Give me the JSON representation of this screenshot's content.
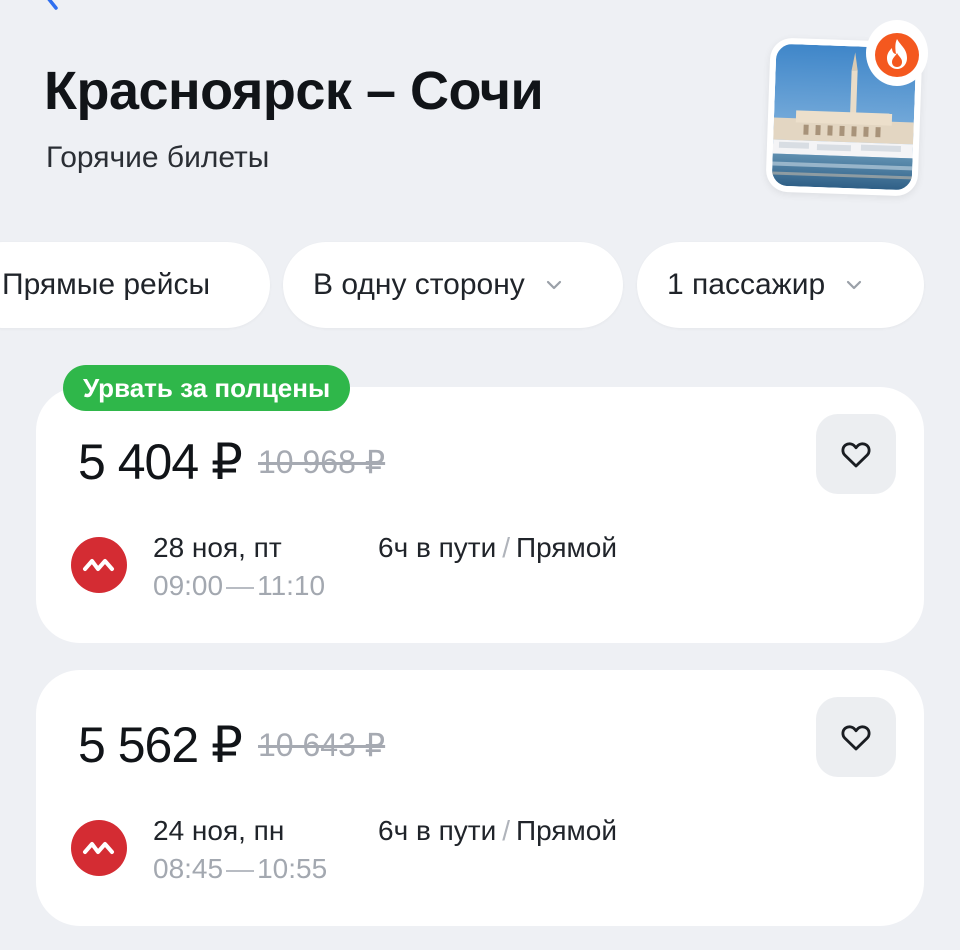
{
  "header": {
    "back_icon": "chevron-left-icon",
    "title": "Красноярск – Сочи",
    "subtitle": "Горячие билеты",
    "photo_icon": "sochi-seaport-photo",
    "hot_icon": "fire-icon"
  },
  "filters": [
    {
      "label": "Прямые рейсы",
      "dropdown": false
    },
    {
      "label": "В одну сторону",
      "dropdown": true
    },
    {
      "label": "1 пассажир",
      "dropdown": true
    }
  ],
  "offers": [
    {
      "badge": "Урвать за полцены",
      "price": "5 404 ₽",
      "old_price": "10 968 ₽",
      "date": "28 ноя, пт",
      "depart": "09:00",
      "arrive": "11:10",
      "duration": "6ч в пути",
      "stops": "Прямой",
      "airline_icon": "nordwind-logo-icon"
    },
    {
      "badge": "",
      "price": "5 562 ₽",
      "old_price": "10 643 ₽",
      "date": "24 ноя, пн",
      "depart": "08:45",
      "arrive": "10:55",
      "duration": "6ч в пути",
      "stops": "Прямой",
      "airline_icon": "nordwind-logo-icon"
    }
  ],
  "colors": {
    "background": "#eef0f4",
    "accent_green": "#2fb74a",
    "airline_red": "#d42c33",
    "fire_orange": "#f4581f",
    "muted_text": "#a3a8b0"
  }
}
